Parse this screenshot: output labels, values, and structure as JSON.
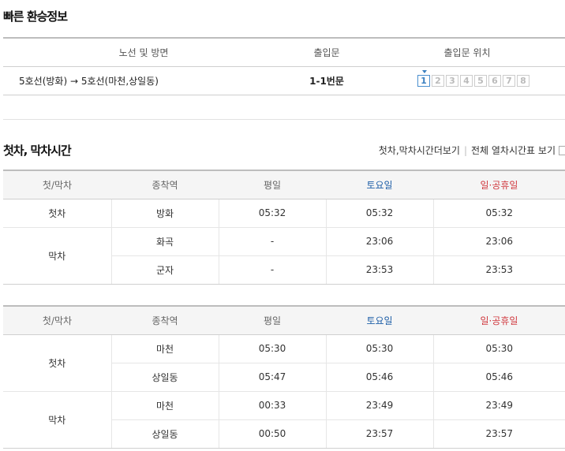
{
  "transfer": {
    "title": "빠른 환승정보",
    "headers": {
      "route": "노선 및 방면",
      "gate": "출입문",
      "gate_position": "출입문 위치"
    },
    "route": "5호선(방화) → 5호선(마천,상일동)",
    "gate": "1-1번문",
    "gate_numbers": [
      "1",
      "2",
      "3",
      "4",
      "5",
      "6",
      "7",
      "8"
    ],
    "active_gate": "1"
  },
  "timetable": {
    "title": "첫차, 막차시간",
    "links": {
      "more_times": "첫차,막차시간더보기",
      "full_schedule": "전체 열차시간표 보기"
    },
    "headers": {
      "kind": "첫/막차",
      "terminal": "종착역",
      "weekday": "평일",
      "saturday": "토요일",
      "holiday": "일·공휴일"
    },
    "table1": {
      "first": {
        "kind": "첫차",
        "rows": [
          {
            "terminal": "방화",
            "weekday": "05:32",
            "saturday": "05:32",
            "holiday": "05:32"
          }
        ]
      },
      "last": {
        "kind": "막차",
        "rows": [
          {
            "terminal": "화곡",
            "weekday": "-",
            "saturday": "23:06",
            "holiday": "23:06"
          },
          {
            "terminal": "군자",
            "weekday": "-",
            "saturday": "23:53",
            "holiday": "23:53"
          }
        ]
      }
    },
    "table2": {
      "first": {
        "kind": "첫차",
        "rows": [
          {
            "terminal": "마천",
            "weekday": "05:30",
            "saturday": "05:30",
            "holiday": "05:30"
          },
          {
            "terminal": "상일동",
            "weekday": "05:47",
            "saturday": "05:46",
            "holiday": "05:46"
          }
        ]
      },
      "last": {
        "kind": "막차",
        "rows": [
          {
            "terminal": "마천",
            "weekday": "00:33",
            "saturday": "23:49",
            "holiday": "23:49"
          },
          {
            "terminal": "상일동",
            "weekday": "00:50",
            "saturday": "23:57",
            "holiday": "23:57"
          }
        ]
      }
    }
  }
}
